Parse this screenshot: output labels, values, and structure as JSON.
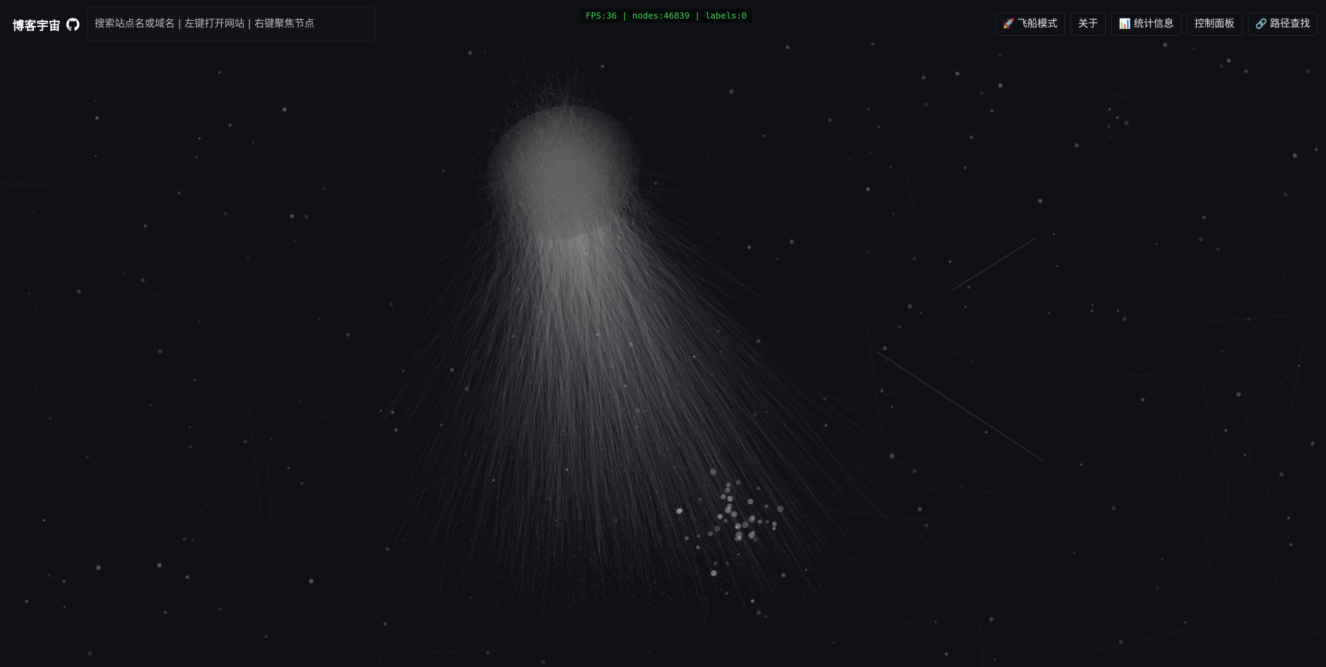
{
  "app": {
    "title": "博客宇宙",
    "github_icon": "github-icon"
  },
  "search": {
    "placeholder": "搜索站点名或域名 | 左键打开网站 | 右键聚焦节点",
    "value": ""
  },
  "stats": {
    "fps_text": "FPS:36 | nodes:46839 | labels:0"
  },
  "nav": {
    "spaceship_icon": "rocket-icon",
    "spaceship_icon_glyph": "🚀",
    "spaceship_label": "飞船模式",
    "about_label": "关于",
    "stats_icon": "bar-chart-icon",
    "stats_icon_glyph": "📊",
    "stats_label": "统计信息",
    "control_label": "控制面板",
    "path_icon": "link-icon",
    "path_icon_glyph": "🔗",
    "path_label": "路径查找"
  },
  "colors": {
    "background": "#0f1116",
    "fps_text": "#3ed44b",
    "node": "#9a9a9a"
  }
}
